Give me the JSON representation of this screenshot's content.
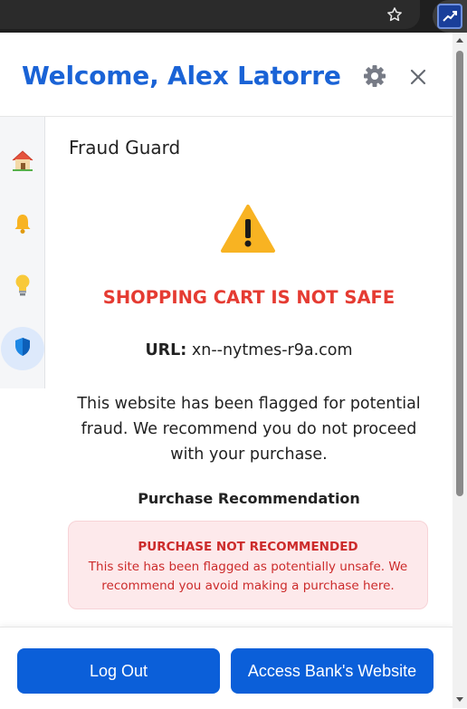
{
  "header": {
    "title": "Welcome, Alex Latorre"
  },
  "icons": {
    "star": "star-outline-icon",
    "extension": "trending-up-icon",
    "gear": "gear-icon",
    "close": "close-icon",
    "home": "house-icon",
    "bell": "bell-icon",
    "bulb": "lightbulb-icon",
    "shield": "shield-icon",
    "warning": "warning-triangle-icon"
  },
  "sidebar": {
    "items": [
      {
        "name": "Home",
        "icon": "house-icon"
      },
      {
        "name": "Notifications",
        "icon": "bell-icon"
      },
      {
        "name": "Tips",
        "icon": "lightbulb-icon"
      },
      {
        "name": "Fraud Guard",
        "icon": "shield-icon",
        "active": true
      }
    ]
  },
  "main": {
    "section_title": "Fraud Guard",
    "alert_title": "SHOPPING CART IS NOT SAFE",
    "url_label": "URL:",
    "url_value": "xn--nytmes-r9a.com",
    "description": "This website has been flagged for potential fraud. We recommend you do not proceed with your purchase.",
    "recommendation_title": "Purchase Recommendation",
    "recommendation_status": "PURCHASE NOT RECOMMENDED",
    "recommendation_body": "This site has been flagged as potentially unsafe. We recommend you avoid making a purchase here."
  },
  "footer": {
    "logout_label": "Log Out",
    "bank_label": "Access Bank's Website"
  },
  "colors": {
    "brand_blue": "#1a63d6",
    "button_blue": "#0b5fd9",
    "danger_red": "#e53b32",
    "alert_bg": "#fde9eb",
    "warning_yellow": "#f8b322"
  }
}
